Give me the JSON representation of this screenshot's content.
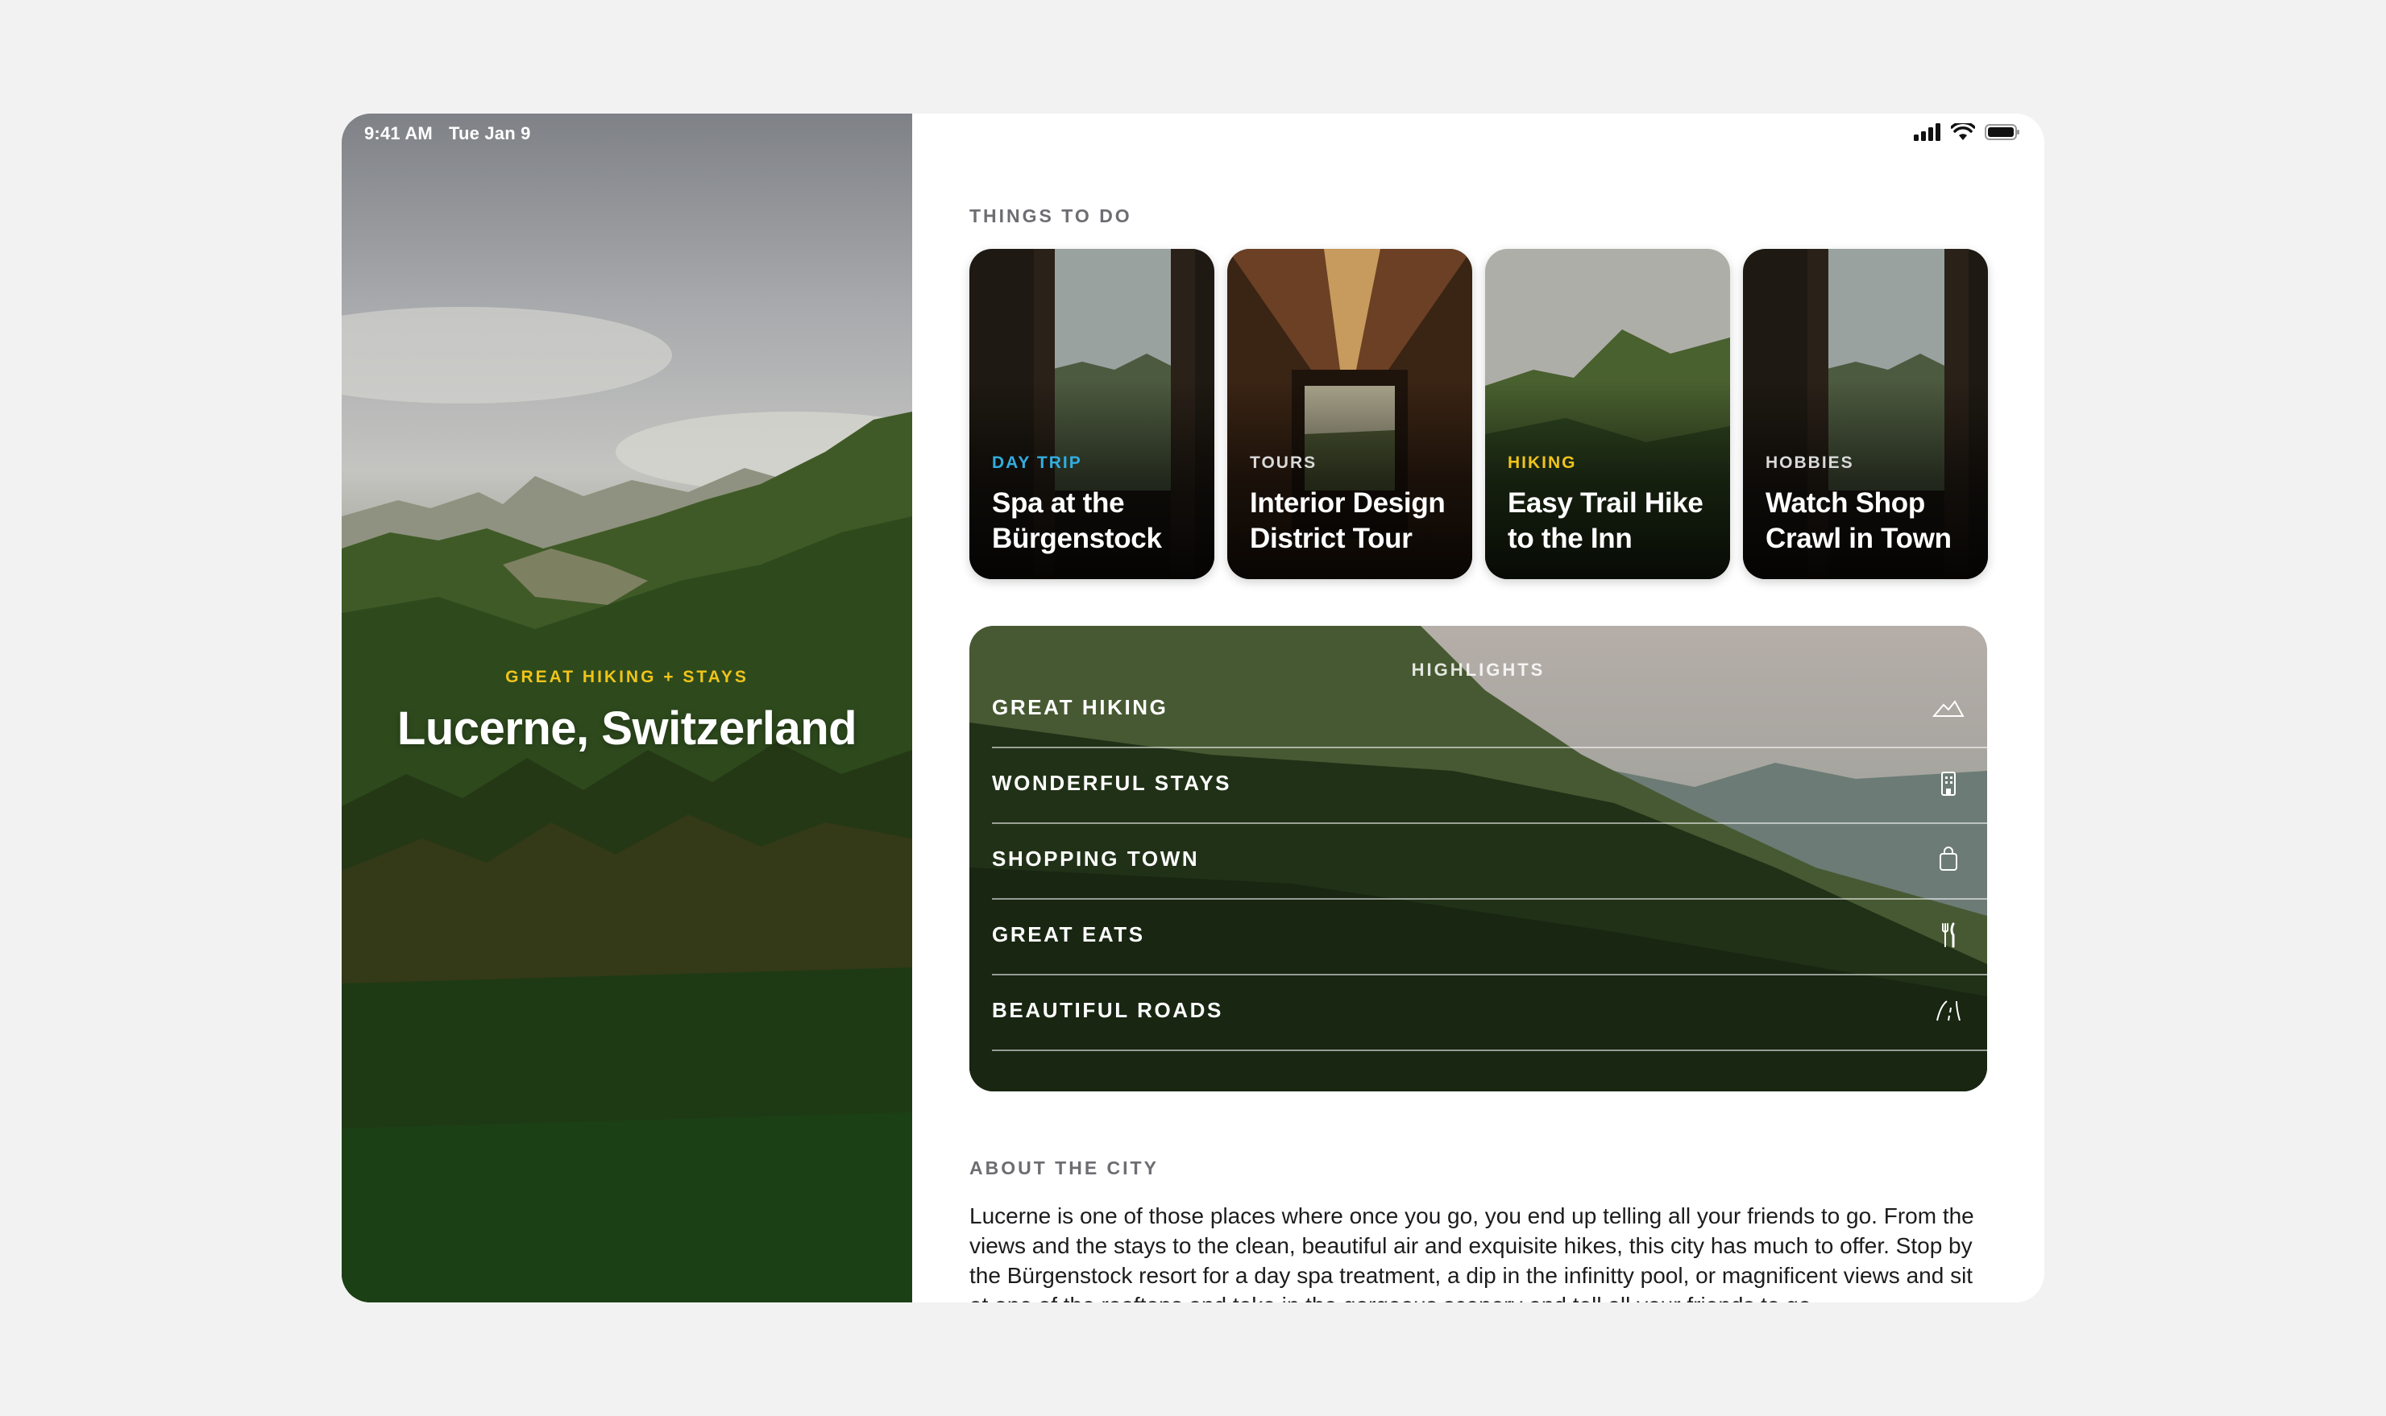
{
  "status": {
    "time": "9:41 AM",
    "date": "Tue Jan 9"
  },
  "hero": {
    "kicker": "GREAT HIKING + STAYS",
    "title": "Lucerne, Switzerland"
  },
  "things_to_do": {
    "label": "THINGS TO DO",
    "cards": [
      {
        "kicker": "DAY TRIP",
        "kicker_color": "#32aee0",
        "title": "Spa at the Bürgenstock"
      },
      {
        "kicker": "TOURS",
        "kicker_color": "#d9d9d9",
        "title": "Interior Design District Tour"
      },
      {
        "kicker": "HIKING",
        "kicker_color": "#f0c419",
        "title": "Easy Trail Hike to the Inn"
      },
      {
        "kicker": "HOBBIES",
        "kicker_color": "#d9d9d9",
        "title": "Watch Shop Crawl in Town"
      }
    ]
  },
  "highlights": {
    "title": "HIGHLIGHTS",
    "items": [
      {
        "label": "GREAT HIKING",
        "icon": "mountain-icon"
      },
      {
        "label": "WONDERFUL STAYS",
        "icon": "building-icon"
      },
      {
        "label": "SHOPPING TOWN",
        "icon": "shopping-bag-icon"
      },
      {
        "label": "GREAT EATS",
        "icon": "fork-knife-icon"
      },
      {
        "label": "BEAUTIFUL ROADS",
        "icon": "road-icon"
      }
    ]
  },
  "about": {
    "label": "ABOUT THE CITY",
    "text": "Lucerne is one of those places where once you go, you end up telling all your friends to go. From the views and the stays to the clean, beautiful air and exquisite hikes, this city has much to offer. Stop by the Bürgenstock resort for a day spa treatment, a dip in the infinitty pool, or magnificent views and sit at one of the rooftops and take in the gorgeous scenery and tell all your friends to go."
  }
}
